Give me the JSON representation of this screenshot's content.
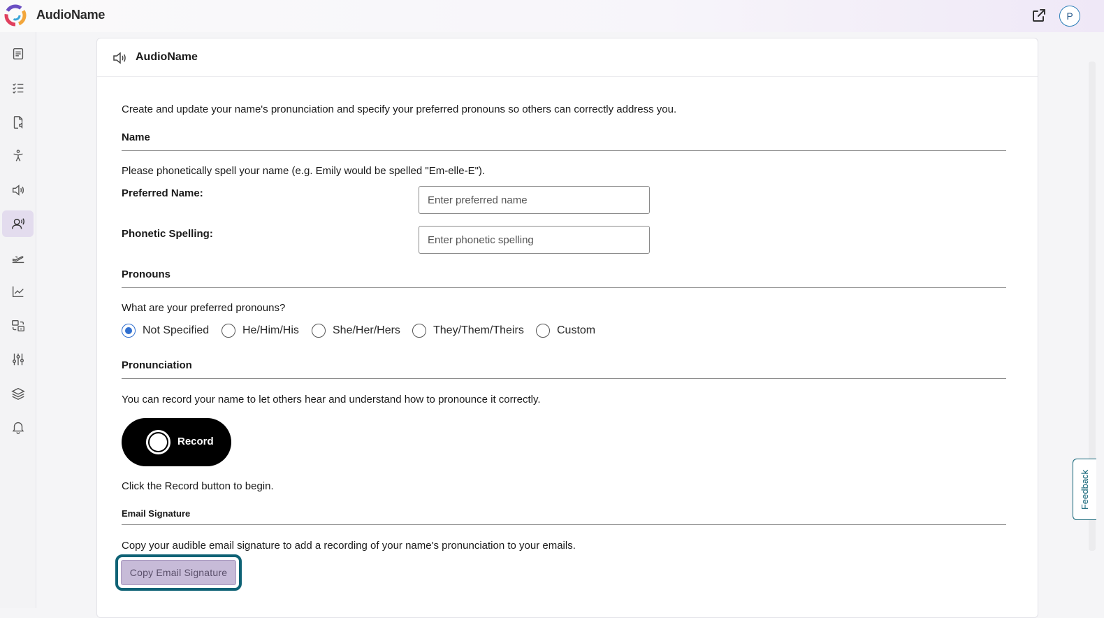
{
  "app": {
    "title": "AudioName",
    "avatar_initial": "P"
  },
  "sidebar": {
    "items": [
      {
        "name": "document-icon"
      },
      {
        "name": "checklist-icon"
      },
      {
        "name": "audio-file-icon"
      },
      {
        "name": "accessibility-icon"
      },
      {
        "name": "speaker-icon"
      },
      {
        "name": "audio-name-icon",
        "active": true
      },
      {
        "name": "airplane-icon"
      },
      {
        "name": "chart-icon"
      },
      {
        "name": "translate-icon"
      },
      {
        "name": "sliders-icon"
      },
      {
        "name": "layers-icon"
      },
      {
        "name": "bell-icon"
      }
    ]
  },
  "card": {
    "title": "AudioName",
    "intro": "Create and update your name's pronunciation and specify your preferred pronouns so others can correctly address you.",
    "name_section": {
      "title": "Name",
      "instruction": "Please phonetically spell your name (e.g. Emily would be spelled \"Em-elle-E\").",
      "preferred_label": "Preferred Name:",
      "preferred_placeholder": "Enter preferred name",
      "preferred_value": "",
      "phonetic_label": "Phonetic Spelling:",
      "phonetic_placeholder": "Enter phonetic spelling",
      "phonetic_value": ""
    },
    "pronouns_section": {
      "title": "Pronouns",
      "question": "What are your preferred pronouns?",
      "options": [
        {
          "label": "Not Specified",
          "checked": true
        },
        {
          "label": "He/Him/His",
          "checked": false
        },
        {
          "label": "She/Her/Hers",
          "checked": false
        },
        {
          "label": "They/Them/Theirs",
          "checked": false
        },
        {
          "label": "Custom",
          "checked": false
        }
      ]
    },
    "pronunciation_section": {
      "title": "Pronunciation",
      "instruction": "You can record your name to let others hear and understand how to pronounce it correctly.",
      "record_label": "Record",
      "hint": "Click the Record button to begin."
    },
    "email_section": {
      "title": "Email Signature",
      "instruction": "Copy your audible email signature to add a recording of your name's pronunciation to your emails.",
      "copy_label": "Copy Email Signature"
    }
  },
  "feedback": {
    "label": "Feedback"
  },
  "colors": {
    "accent": "#0e6275",
    "radio": "#2f6fd0",
    "active_nav": "#e3dcee",
    "copy_button": "#c7bbd8"
  }
}
